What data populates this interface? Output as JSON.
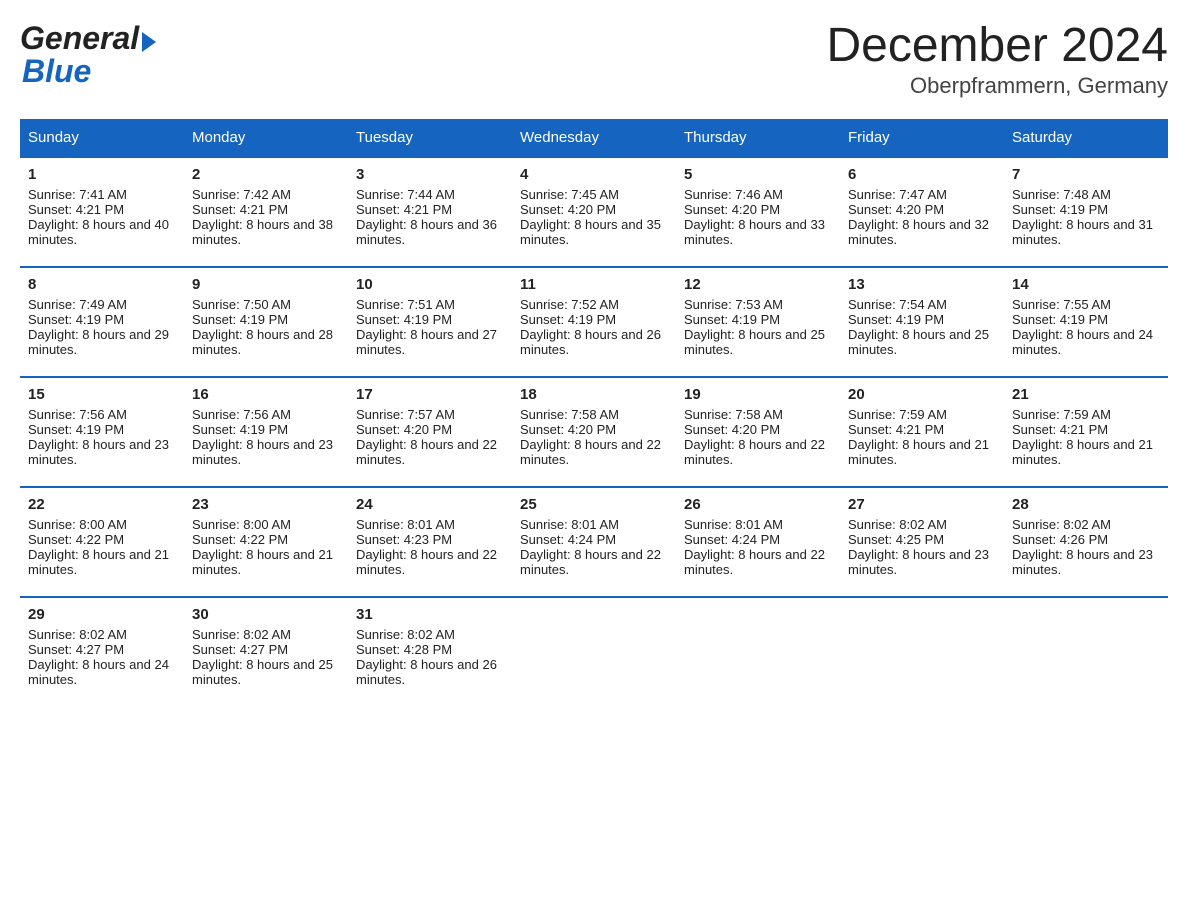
{
  "logo": {
    "general": "General",
    "blue": "Blue"
  },
  "title": "December 2024",
  "subtitle": "Oberpframmern, Germany",
  "days": [
    "Sunday",
    "Monday",
    "Tuesday",
    "Wednesday",
    "Thursday",
    "Friday",
    "Saturday"
  ],
  "weeks": [
    [
      {
        "num": "1",
        "sunrise": "7:41 AM",
        "sunset": "4:21 PM",
        "daylight": "8 hours and 40 minutes."
      },
      {
        "num": "2",
        "sunrise": "7:42 AM",
        "sunset": "4:21 PM",
        "daylight": "8 hours and 38 minutes."
      },
      {
        "num": "3",
        "sunrise": "7:44 AM",
        "sunset": "4:21 PM",
        "daylight": "8 hours and 36 minutes."
      },
      {
        "num": "4",
        "sunrise": "7:45 AM",
        "sunset": "4:20 PM",
        "daylight": "8 hours and 35 minutes."
      },
      {
        "num": "5",
        "sunrise": "7:46 AM",
        "sunset": "4:20 PM",
        "daylight": "8 hours and 33 minutes."
      },
      {
        "num": "6",
        "sunrise": "7:47 AM",
        "sunset": "4:20 PM",
        "daylight": "8 hours and 32 minutes."
      },
      {
        "num": "7",
        "sunrise": "7:48 AM",
        "sunset": "4:19 PM",
        "daylight": "8 hours and 31 minutes."
      }
    ],
    [
      {
        "num": "8",
        "sunrise": "7:49 AM",
        "sunset": "4:19 PM",
        "daylight": "8 hours and 29 minutes."
      },
      {
        "num": "9",
        "sunrise": "7:50 AM",
        "sunset": "4:19 PM",
        "daylight": "8 hours and 28 minutes."
      },
      {
        "num": "10",
        "sunrise": "7:51 AM",
        "sunset": "4:19 PM",
        "daylight": "8 hours and 27 minutes."
      },
      {
        "num": "11",
        "sunrise": "7:52 AM",
        "sunset": "4:19 PM",
        "daylight": "8 hours and 26 minutes."
      },
      {
        "num": "12",
        "sunrise": "7:53 AM",
        "sunset": "4:19 PM",
        "daylight": "8 hours and 25 minutes."
      },
      {
        "num": "13",
        "sunrise": "7:54 AM",
        "sunset": "4:19 PM",
        "daylight": "8 hours and 25 minutes."
      },
      {
        "num": "14",
        "sunrise": "7:55 AM",
        "sunset": "4:19 PM",
        "daylight": "8 hours and 24 minutes."
      }
    ],
    [
      {
        "num": "15",
        "sunrise": "7:56 AM",
        "sunset": "4:19 PM",
        "daylight": "8 hours and 23 minutes."
      },
      {
        "num": "16",
        "sunrise": "7:56 AM",
        "sunset": "4:19 PM",
        "daylight": "8 hours and 23 minutes."
      },
      {
        "num": "17",
        "sunrise": "7:57 AM",
        "sunset": "4:20 PM",
        "daylight": "8 hours and 22 minutes."
      },
      {
        "num": "18",
        "sunrise": "7:58 AM",
        "sunset": "4:20 PM",
        "daylight": "8 hours and 22 minutes."
      },
      {
        "num": "19",
        "sunrise": "7:58 AM",
        "sunset": "4:20 PM",
        "daylight": "8 hours and 22 minutes."
      },
      {
        "num": "20",
        "sunrise": "7:59 AM",
        "sunset": "4:21 PM",
        "daylight": "8 hours and 21 minutes."
      },
      {
        "num": "21",
        "sunrise": "7:59 AM",
        "sunset": "4:21 PM",
        "daylight": "8 hours and 21 minutes."
      }
    ],
    [
      {
        "num": "22",
        "sunrise": "8:00 AM",
        "sunset": "4:22 PM",
        "daylight": "8 hours and 21 minutes."
      },
      {
        "num": "23",
        "sunrise": "8:00 AM",
        "sunset": "4:22 PM",
        "daylight": "8 hours and 21 minutes."
      },
      {
        "num": "24",
        "sunrise": "8:01 AM",
        "sunset": "4:23 PM",
        "daylight": "8 hours and 22 minutes."
      },
      {
        "num": "25",
        "sunrise": "8:01 AM",
        "sunset": "4:24 PM",
        "daylight": "8 hours and 22 minutes."
      },
      {
        "num": "26",
        "sunrise": "8:01 AM",
        "sunset": "4:24 PM",
        "daylight": "8 hours and 22 minutes."
      },
      {
        "num": "27",
        "sunrise": "8:02 AM",
        "sunset": "4:25 PM",
        "daylight": "8 hours and 23 minutes."
      },
      {
        "num": "28",
        "sunrise": "8:02 AM",
        "sunset": "4:26 PM",
        "daylight": "8 hours and 23 minutes."
      }
    ],
    [
      {
        "num": "29",
        "sunrise": "8:02 AM",
        "sunset": "4:27 PM",
        "daylight": "8 hours and 24 minutes."
      },
      {
        "num": "30",
        "sunrise": "8:02 AM",
        "sunset": "4:27 PM",
        "daylight": "8 hours and 25 minutes."
      },
      {
        "num": "31",
        "sunrise": "8:02 AM",
        "sunset": "4:28 PM",
        "daylight": "8 hours and 26 minutes."
      },
      null,
      null,
      null,
      null
    ]
  ]
}
